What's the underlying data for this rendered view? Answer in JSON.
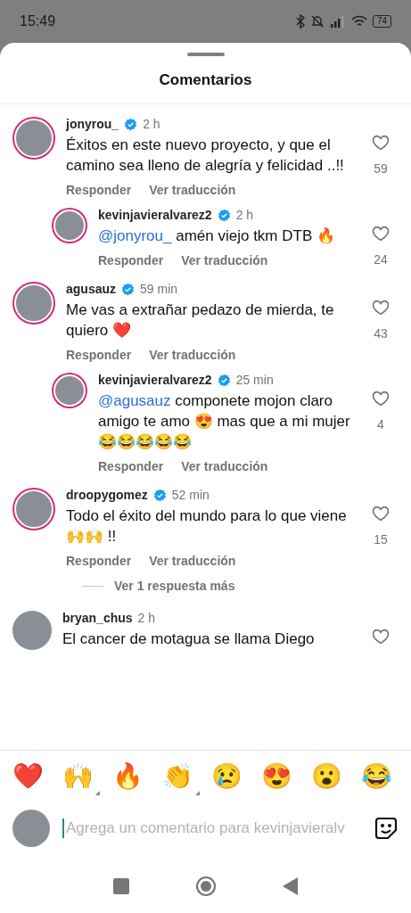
{
  "status_bar": {
    "time": "15:49",
    "battery": "74"
  },
  "sheet": {
    "title": "Comentarios"
  },
  "comments": [
    {
      "user": "jonyrou_",
      "verified": true,
      "story_ring": true,
      "time": "2 h",
      "text": "Éxitos en este nuevo proyecto, y que el camino sea lleno de alegría y felicidad ..!!",
      "likes": "59",
      "actions": [
        "Responder",
        "Ver traducción"
      ],
      "replies": [
        {
          "user": "kevinjavieralvarez2",
          "verified": true,
          "story_ring": true,
          "time": "2 h",
          "mention": "@jonyrou_",
          "text": "amén viejo tkm DTB 🔥",
          "likes": "24",
          "actions": [
            "Responder",
            "Ver traducción"
          ]
        }
      ]
    },
    {
      "user": "agusauz",
      "verified": true,
      "story_ring": true,
      "time": "59 min",
      "text": "Me vas a extrañar pedazo de mierda, te quiero ❤️",
      "likes": "43",
      "actions": [
        "Responder",
        "Ver traducción"
      ],
      "replies": [
        {
          "user": "kevinjavieralvarez2",
          "verified": true,
          "story_ring": true,
          "time": "25 min",
          "mention": "@agusauz",
          "text": "componete mojon claro amigo te amo 😍 mas que a mi mujer 😂😂😂😂😂",
          "likes": "4",
          "actions": [
            "Responder",
            "Ver traducción"
          ]
        }
      ]
    },
    {
      "user": "droopygomez",
      "verified": true,
      "story_ring": true,
      "time": "52 min",
      "text": "Todo el éxito del mundo para lo que viene 🙌🙌 !!",
      "likes": "15",
      "actions": [
        "Responder",
        "Ver traducción"
      ],
      "more_replies": "Ver 1 respuesta más"
    },
    {
      "user": "bryan_chus",
      "verified": false,
      "story_ring": false,
      "time": "2 h",
      "text": "El cancer de motagua se llama Diego"
    }
  ],
  "reactions": [
    {
      "emoji": "❤️",
      "variants": false
    },
    {
      "emoji": "🙌",
      "variants": true
    },
    {
      "emoji": "🔥",
      "variants": false
    },
    {
      "emoji": "👏",
      "variants": true
    },
    {
      "emoji": "😢",
      "variants": false
    },
    {
      "emoji": "😍",
      "variants": false
    },
    {
      "emoji": "😮",
      "variants": false
    },
    {
      "emoji": "😂",
      "variants": false
    }
  ],
  "composer": {
    "placeholder": "Agrega un comentario para kevinjavieralv"
  }
}
